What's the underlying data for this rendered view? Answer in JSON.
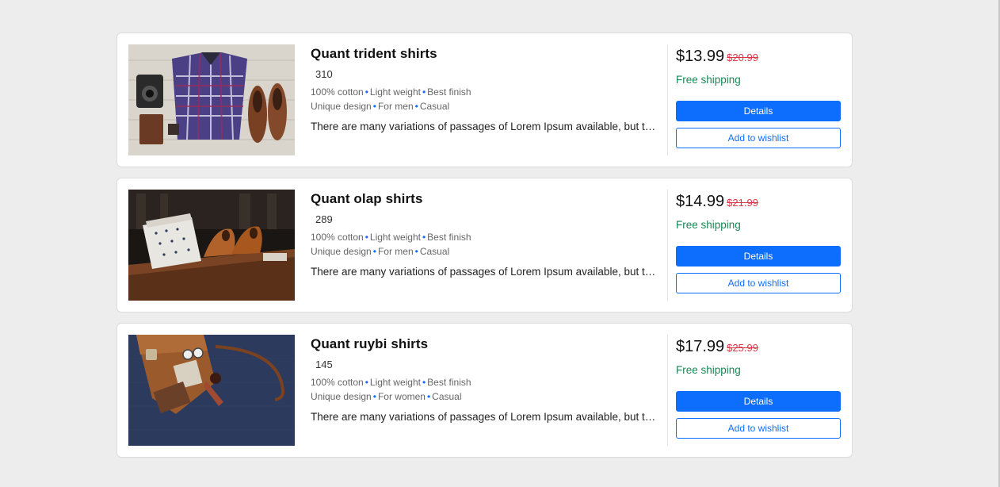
{
  "products": [
    {
      "title": "Quant trident shirts",
      "count": "310",
      "features_line1": [
        "100% cotton",
        "Light weight",
        "Best finish"
      ],
      "features_line2": [
        "Unique design",
        "For men",
        "Casual"
      ],
      "description": "There are many variations of passages of Lorem Ipsum available, but the majority have suffered alteration",
      "price": "$13.99",
      "old_price": "$20.99",
      "shipping": "Free shipping",
      "details_label": "Details",
      "wishlist_label": "Add to wishlist",
      "image_label": "flat-lay plaid shirt, camera, wallet and brown shoes"
    },
    {
      "title": "Quant olap shirts",
      "count": "289",
      "features_line1": [
        "100% cotton",
        "Light weight",
        "Best finish"
      ],
      "features_line2": [
        "Unique design",
        "For men",
        "Casual"
      ],
      "description": "There are many variations of passages of Lorem Ipsum available, but the majority have suffered alteration",
      "price": "$14.99",
      "old_price": "$21.99",
      "shipping": "Free shipping",
      "details_label": "Details",
      "wishlist_label": "Add to wishlist",
      "image_label": "folded shirts and brown leather shoes on wooden table"
    },
    {
      "title": "Quant ruybi shirts",
      "count": "145",
      "features_line1": [
        "100% cotton",
        "Light weight",
        "Best finish"
      ],
      "features_line2": [
        "Unique design",
        "For women",
        "Casual"
      ],
      "description": "There are many variations of passages of Lorem Ipsum available, but the majority have suffered alteration",
      "price": "$17.99",
      "old_price": "$25.99",
      "shipping": "Free shipping",
      "details_label": "Details",
      "wishlist_label": "Add to wishlist",
      "image_label": "brown leather bag with accessories on navy background"
    }
  ],
  "colors": {
    "primary": "#0d6efd",
    "old_price": "#dc3545",
    "shipping": "#198754",
    "background": "#ededed"
  }
}
